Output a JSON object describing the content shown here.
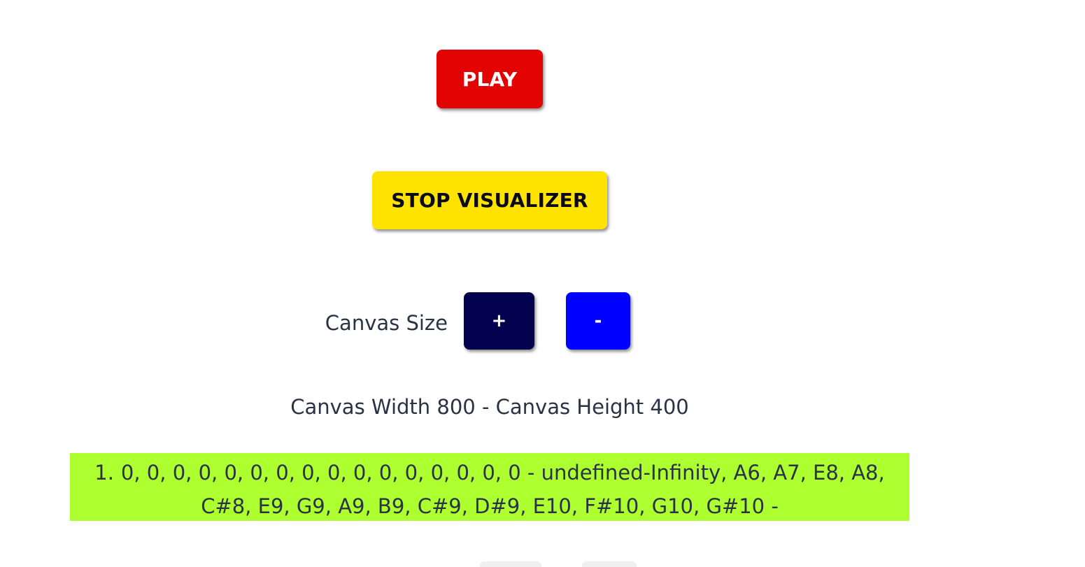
{
  "controls": {
    "play_label": "PLAY",
    "stop_visualizer_label": "STOP VISUALIZER",
    "canvas_size_label": "Canvas Size",
    "increase_label": "+",
    "decrease_label": "-"
  },
  "canvas": {
    "dimensions_text": "Canvas Width 800 - Canvas Height 400"
  },
  "results": [
    {
      "index": "1.",
      "text": "0, 0, 0, 0, 0, 0, 0, 0, 0, 0, 0, 0, 0, 0, 0, 0 - undefined-Infinity, A6, A7, E8, A8, C#8, E9, G9, A9, B9, C#9, D#9, E10, F#10, G10, G#10 -"
    }
  ],
  "colors": {
    "play": "#e20303",
    "stop_visualizer": "#ffe300",
    "increase": "#02024f",
    "decrease": "#0000ff",
    "result_background": "#adff2f"
  }
}
